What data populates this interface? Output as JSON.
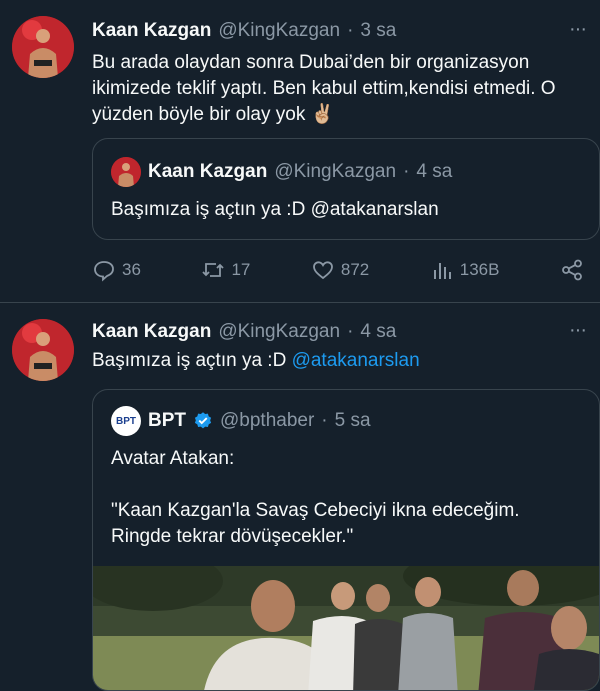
{
  "tweet1": {
    "name": "Kaan Kazgan",
    "handle": "@KingKazgan",
    "dot": "·",
    "time": "3 sa",
    "text": "Bu arada olaydan sonra Dubai’den bir organizasyon ikimizede teklif yaptı. Ben kabul ettim,kendisi etmedi. O yüzden böyle bir olay yok ✌🏼",
    "quote": {
      "name": "Kaan Kazgan",
      "handle": "@KingKazgan",
      "dot": "·",
      "time": "4 sa",
      "text": "Başımıza iş açtın ya :D @atakanarslan"
    },
    "actions": {
      "replies": "36",
      "retweets": "17",
      "likes": "872",
      "views": "136B"
    }
  },
  "tweet2": {
    "name": "Kaan Kazgan",
    "handle": "@KingKazgan",
    "dot": "·",
    "time": "4 sa",
    "text_before": "Başımıza iş açtın ya :D ",
    "mention": "@atakanarslan",
    "quote": {
      "logo_text": "BPT",
      "name": "BPT",
      "handle": "@bpthaber",
      "dot": "·",
      "time": "5 sa",
      "line1": "Avatar Atakan:",
      "line2": "\"Kaan Kazgan'la Savaş Cebeciyi ikna edeceğim. Ringde tekrar dövüşecekler.\""
    }
  },
  "icons": {
    "reply": "reply-icon",
    "retweet": "retweet-icon",
    "like": "heart-icon",
    "views": "views-icon",
    "share": "share-icon",
    "more": "more-icon",
    "verified": "verified-badge-icon"
  },
  "colors": {
    "background": "#15202b",
    "text": "#f7f9f9",
    "secondary": "#8b98a5",
    "accent": "#1d9bf0",
    "border": "#38444d"
  }
}
